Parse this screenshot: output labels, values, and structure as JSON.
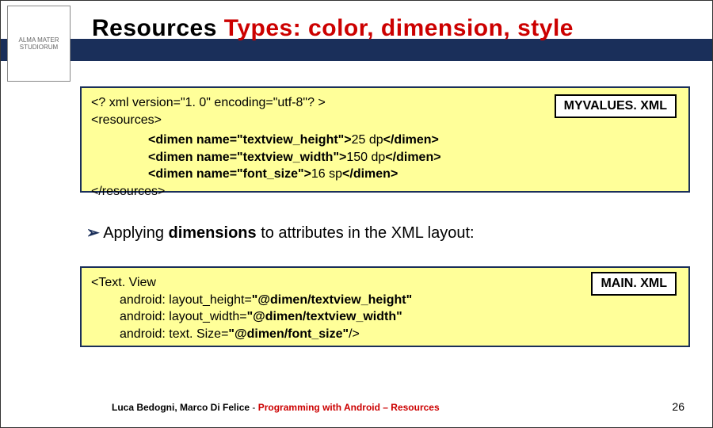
{
  "title": {
    "part1": "Resources ",
    "part2": "Types: color, dimension, style"
  },
  "logo_text": "ALMA MATER STUDIORUM",
  "badges": {
    "top": "MYVALUES. XML",
    "bottom": "MAIN. XML"
  },
  "code1": {
    "l1": "<? xml version=\"1. 0\" encoding=\"utf-8\"? >",
    "l2": "<resources>",
    "l3a": "<dimen name=\"textview_height\">",
    "l3b": "25 dp",
    "l3c": "</dimen>",
    "l4a": "<dimen name=\"textview_width\">",
    "l4b": "150 dp",
    "l4c": "</dimen>",
    "l5a": "<dimen name=\"font_size\">",
    "l5b": "16 sp",
    "l5c": "</dimen>",
    "l6": "</resources>"
  },
  "bullet": {
    "arrow": "➢",
    "pre": " Applying ",
    "bold": "dimensions",
    "post": " to attributes in the XML layout:"
  },
  "code2": {
    "l1": "<Text. View",
    "l2a": "android: layout_height=",
    "l2b": "\"@dimen/textview_height\"",
    "l3a": "android: layout_width=",
    "l3b": "\"@dimen/textview_width\"",
    "l4a": "android: text. Size=",
    "l4b": "\"@dimen/font_size\"",
    "l4c": "/>"
  },
  "footer": {
    "authors": "Luca Bedogni, Marco Di Felice",
    "sep": " - ",
    "course": "Programming with Android – Resources"
  },
  "page_number": "26"
}
